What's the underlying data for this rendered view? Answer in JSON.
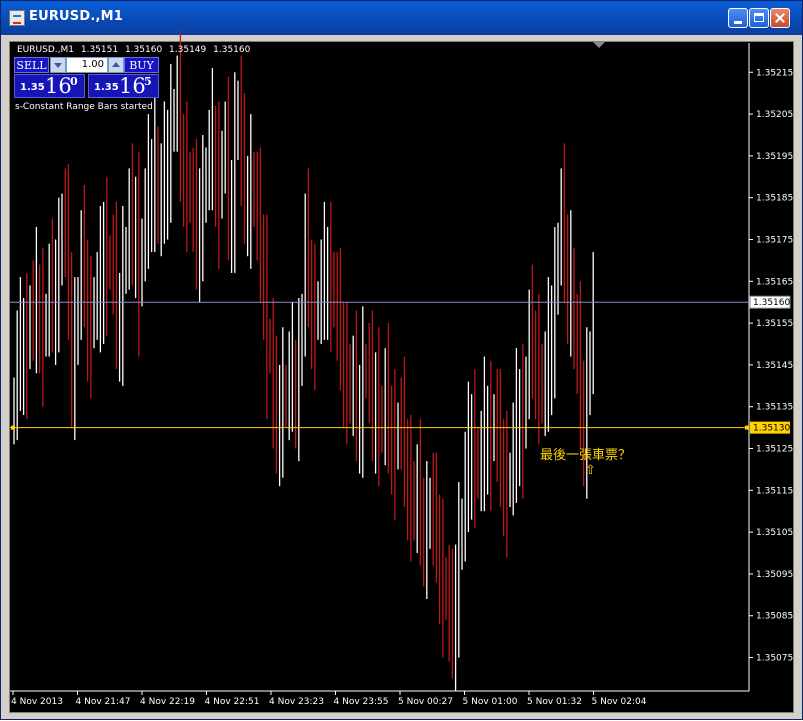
{
  "window": {
    "title": "EURUSD.,M1"
  },
  "ticker": {
    "symbol": "EURUSD.,M1",
    "open": "1.35151",
    "high": "1.35160",
    "low": "1.35149",
    "close": "1.35160"
  },
  "trade_panel": {
    "sell_label": "SELL",
    "buy_label": "BUY",
    "lot_value": "1.00",
    "sell_prefix": "1.35",
    "sell_big": "16",
    "sell_sup": "0",
    "buy_prefix": "1.35",
    "buy_big": "16",
    "buy_sup": "5"
  },
  "status_text": "s-Constant Range Bars started",
  "annotation": {
    "text": "最後一張車票？",
    "arrow": "⇧"
  },
  "colors": {
    "background": "#000000",
    "bull": "#ffffff",
    "bear": "#c01818",
    "grid_line": "#8a8ec8",
    "support_line": "#ffd200",
    "axis_text": "#ffffff"
  },
  "chart_data": {
    "type": "ohlc",
    "symbol": "EURUSD.",
    "timeframe": "M1",
    "ylim": [
      1.35067,
      1.35222
    ],
    "y_ticks": [
      "1.35215",
      "1.35205",
      "1.35195",
      "1.35185",
      "1.35175",
      "1.35165",
      "1.35155",
      "1.35145",
      "1.35135",
      "1.35125",
      "1.35115",
      "1.35105",
      "1.35095",
      "1.35085",
      "1.35075"
    ],
    "x_ticks": [
      "4 Nov 2013",
      "4 Nov 21:47",
      "4 Nov 22:19",
      "4 Nov 22:51",
      "4 Nov 23:23",
      "4 Nov 23:55",
      "5 Nov 00:27",
      "5 Nov 01:00",
      "5 Nov 01:32",
      "5 Nov 02:04"
    ],
    "current_price": "1.35160",
    "support_price": "1.35130",
    "close_series": [
      1.35136,
      1.35146,
      1.35148,
      1.35152,
      1.3515,
      1.35158,
      1.35155,
      1.3516,
      1.35158,
      1.35153,
      1.35156,
      1.35162,
      1.3516,
      1.35166,
      1.3517,
      1.3518,
      1.35175,
      1.35163,
      1.35145,
      1.35151,
      1.3516,
      1.3517,
      1.35166,
      1.35156,
      1.35155,
      1.3516,
      1.3516,
      1.35165,
      1.35175,
      1.3517,
      1.35169,
      1.35166,
      1.35156,
      1.35158,
      1.35168,
      1.35172,
      1.3518,
      1.35176,
      1.35181,
      1.35165,
      1.35174,
      1.3518,
      1.35187,
      1.3519,
      1.35196,
      1.3518,
      1.35186,
      1.3519,
      1.35197,
      1.35202,
      1.35205,
      1.35207,
      1.35196,
      1.35193,
      1.3519,
      1.35185,
      1.35181,
      1.35175,
      1.35183,
      1.35185,
      1.35191,
      1.35194,
      1.35198,
      1.35193,
      1.35186,
      1.35195,
      1.35196,
      1.35182,
      1.35185,
      1.352,
      1.35207,
      1.35192,
      1.35186,
      1.35186,
      1.3519,
      1.35184,
      1.35179,
      1.35172,
      1.35166,
      1.3515,
      1.35149,
      1.35134,
      1.35131,
      1.35136,
      1.35139,
      1.35136,
      1.35141,
      1.35142,
      1.3514,
      1.35146,
      1.35156,
      1.35174,
      1.35166,
      1.35159,
      1.35157,
      1.35159,
      1.35163,
      1.35166,
      1.35169,
      1.35166,
      1.3516,
      1.35155,
      1.35151,
      1.35145,
      1.35144,
      1.35137,
      1.3514,
      1.35134,
      1.35136,
      1.35144,
      1.35143,
      1.3514,
      1.35134,
      1.35139,
      1.35134,
      1.3513,
      1.35137,
      1.35131,
      1.35129,
      1.35126,
      1.3513,
      1.35129,
      1.35123,
      1.35118,
      1.35116,
      1.35109,
      1.35114,
      1.35109,
      1.35107,
      1.35107,
      1.35112,
      1.35106,
      1.35105,
      1.35098,
      1.35093,
      1.3509,
      1.35083,
      1.35082,
      1.35093,
      1.35102,
      1.35107,
      1.35117,
      1.35123,
      1.35129,
      1.35124,
      1.35119,
      1.35122,
      1.35129,
      1.35131,
      1.35128,
      1.35132,
      1.35126,
      1.35123,
      1.35119,
      1.35117,
      1.35118,
      1.35124,
      1.35131,
      1.35135,
      1.35131,
      1.35141,
      1.35151,
      1.35149,
      1.35147,
      1.35144,
      1.35137,
      1.35141,
      1.35148,
      1.35155,
      1.35163,
      1.35173,
      1.3518,
      1.35172,
      1.35165,
      1.35167,
      1.3515,
      1.35147,
      1.35137,
      1.35131,
      1.35139,
      1.35147,
      1.3516
    ]
  }
}
